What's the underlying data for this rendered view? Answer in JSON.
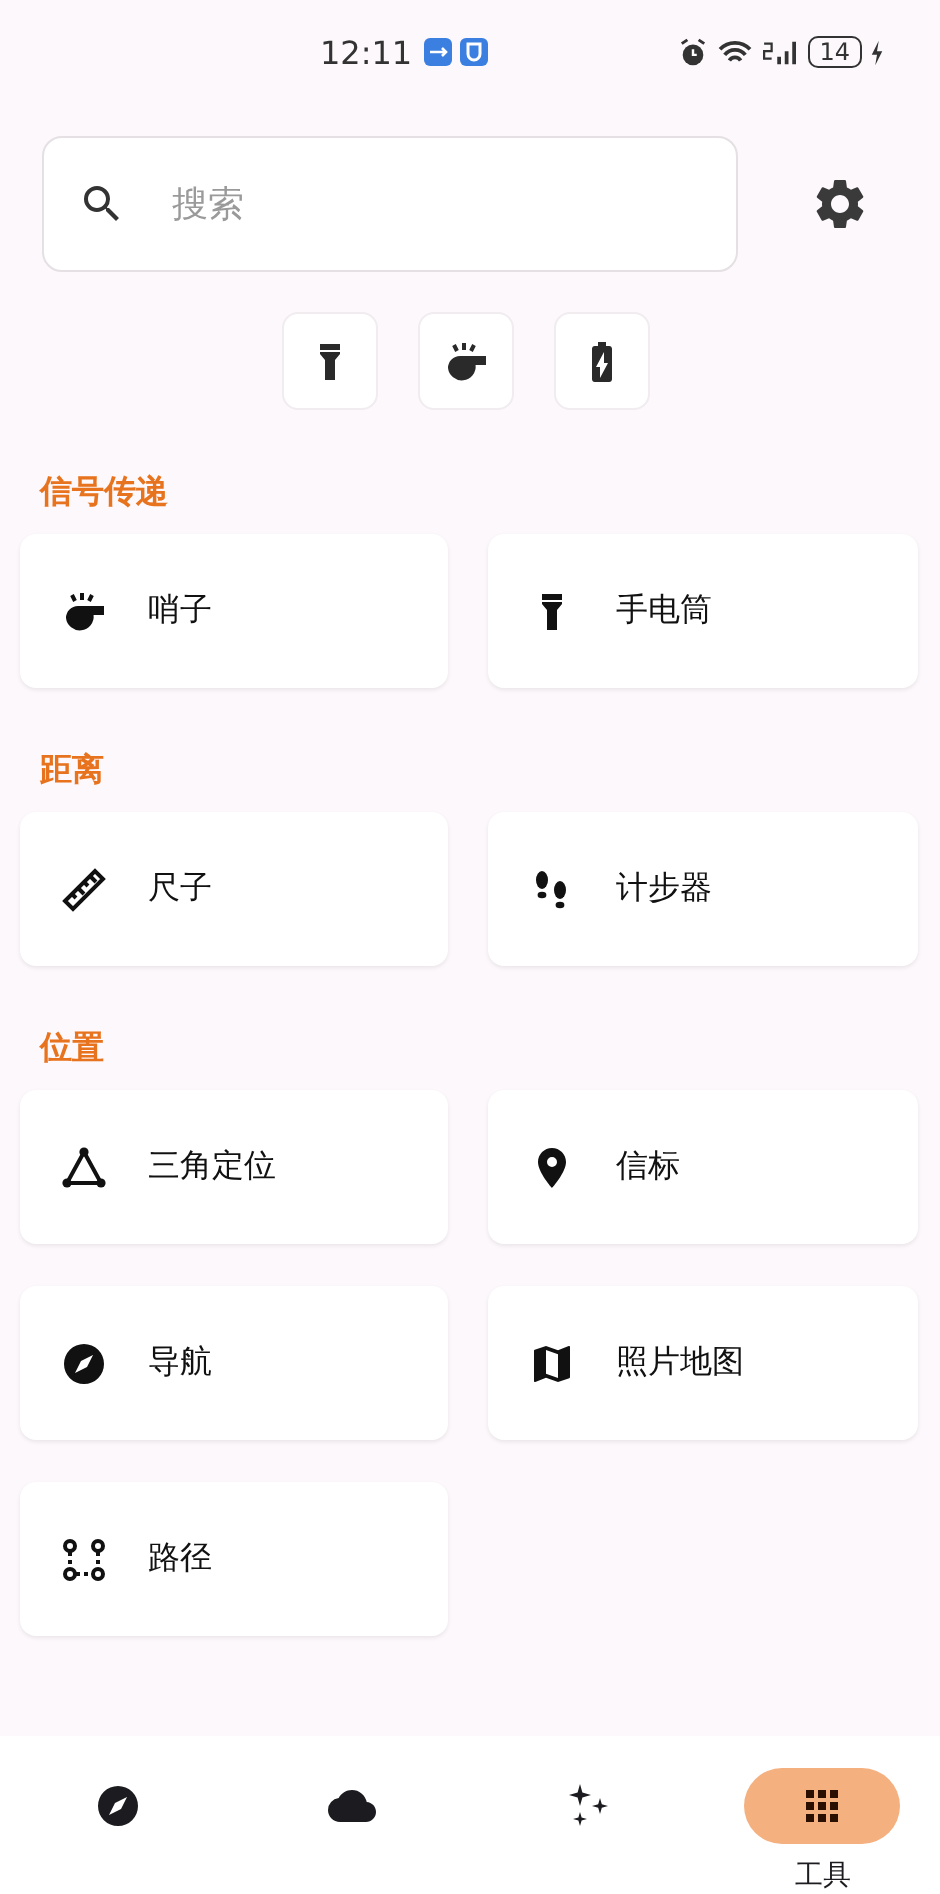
{
  "status_bar": {
    "time": "12:11",
    "battery": "14"
  },
  "search": {
    "placeholder": "搜索"
  },
  "quick_actions": [
    {
      "kind": "flashlight"
    },
    {
      "kind": "whistle"
    },
    {
      "kind": "battery"
    }
  ],
  "sections": [
    {
      "title": "信号传递",
      "tools": [
        {
          "label": "哨子",
          "kind": "whistle"
        },
        {
          "label": "手电筒",
          "kind": "flashlight"
        }
      ]
    },
    {
      "title": "距离",
      "tools": [
        {
          "label": "尺子",
          "kind": "ruler"
        },
        {
          "label": "计步器",
          "kind": "footprints"
        }
      ]
    },
    {
      "title": "位置",
      "tools": [
        {
          "label": "三角定位",
          "kind": "triangle"
        },
        {
          "label": "信标",
          "kind": "pin"
        },
        {
          "label": "导航",
          "kind": "compass"
        },
        {
          "label": "照片地图",
          "kind": "map"
        },
        {
          "label": "路径",
          "kind": "route"
        }
      ]
    }
  ],
  "bottom_nav": [
    {
      "kind": "compass",
      "selected": false
    },
    {
      "kind": "cloud",
      "selected": false
    },
    {
      "kind": "sparkles",
      "selected": false
    },
    {
      "kind": "grid",
      "selected": true,
      "label": "工具"
    }
  ]
}
